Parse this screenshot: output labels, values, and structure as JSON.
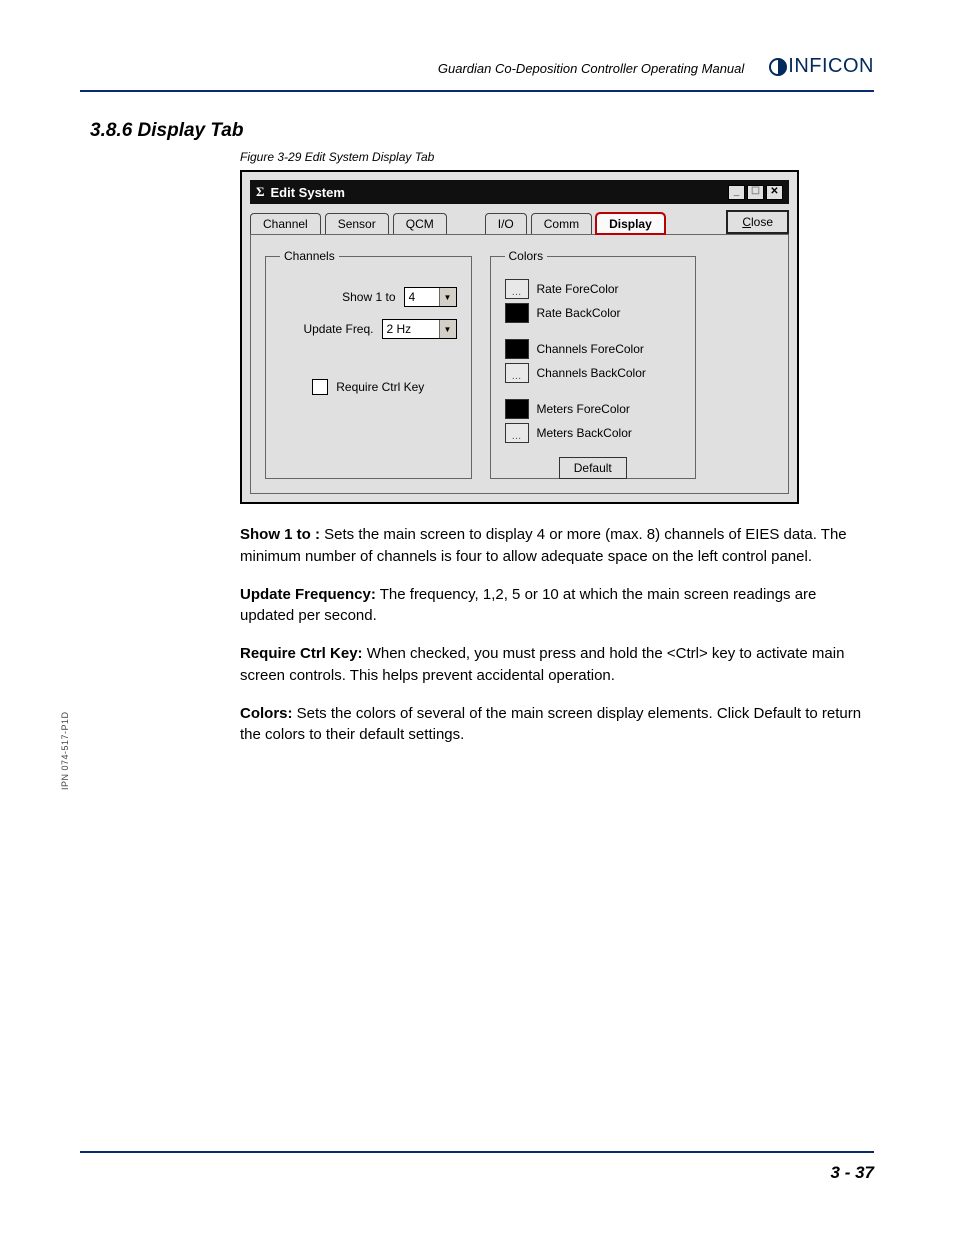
{
  "header": {
    "manual_title": "Guardian Co-Deposition Controller Operating Manual",
    "brand": "INFICON"
  },
  "section": {
    "number_title": "3.8.6  Display Tab",
    "figure_caption": "Figure 3-29  Edit System Display Tab"
  },
  "dialog": {
    "title": "Edit System",
    "tabs": [
      "Channel",
      "Sensor",
      "QCM",
      "I/O",
      "Comm",
      "Display"
    ],
    "active_tab_index": 5,
    "close_label": "Close",
    "channels_group": {
      "legend": "Channels",
      "show_label": "Show 1 to",
      "show_value": "4",
      "freq_label": "Update Freq.",
      "freq_value": "2 Hz",
      "ctrl_key_label": "Require Ctrl Key"
    },
    "colors_group": {
      "legend": "Colors",
      "items": [
        {
          "swatch": "light",
          "label": "Rate ForeColor"
        },
        {
          "swatch": "black",
          "label": "Rate BackColor"
        },
        {
          "swatch": "black",
          "label": "Channels ForeColor"
        },
        {
          "swatch": "light",
          "label": "Channels BackColor"
        },
        {
          "swatch": "black",
          "label": "Meters ForeColor"
        },
        {
          "swatch": "light",
          "label": "Meters BackColor"
        }
      ],
      "default_label": "Default"
    }
  },
  "paragraphs": {
    "p1_b": "Show 1 to :",
    "p1": " Sets the main screen to display 4 or more (max. 8) channels of EIES data. The minimum number of channels is four to allow adequate space on the left control panel.",
    "p2_b": "Update Frequency:",
    "p2": " The frequency, 1,2, 5 or 10 at which the main screen readings are updated per second.",
    "p3_b": "Require Ctrl Key:",
    "p3": " When checked, you must press and hold the <Ctrl> key to activate main screen controls. This helps prevent accidental operation.",
    "p4_b": "Colors:",
    "p4": " Sets the colors of several of the main screen display elements. Click Default to return the colors to their default settings."
  },
  "side_text": "IPN 074-517-P1D",
  "page_number": "3 - 37"
}
